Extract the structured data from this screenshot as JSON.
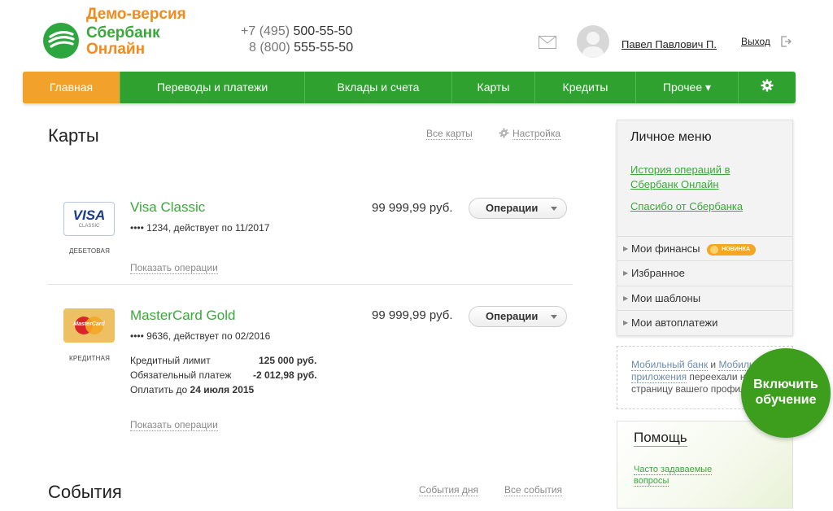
{
  "header": {
    "demo_label": "Демо-версия",
    "brand_line1": "Сбербанк",
    "brand_line2": "Онлайн",
    "phone1_prefix": "+7 (495)",
    "phone1_number": "500-55-50",
    "phone2_prefix": "8 (800)",
    "phone2_number": "555-55-50",
    "user_name": "Павел Павлович П.",
    "logout_label": "Выход"
  },
  "nav": {
    "items": [
      {
        "label": "Главная",
        "active": true
      },
      {
        "label": "Переводы и платежи"
      },
      {
        "label": "Вклады и счета"
      },
      {
        "label": "Карты"
      },
      {
        "label": "Кредиты"
      },
      {
        "label": "Прочее ▾"
      }
    ],
    "settings_icon": "gear-icon"
  },
  "cards_section": {
    "title": "Карты",
    "all_cards_link": "Все карты",
    "settings_link": "Настройка",
    "cards": [
      {
        "logo_text": "VISA",
        "logo_sub": "CLASSIC",
        "type_label": "ДЕБЕТОВАЯ",
        "name": "Visa Classic",
        "number_line": "•••• 1234, действует по 11/2017",
        "amount": "99 999,99 руб.",
        "ops_label": "Операции",
        "show_ops_link": "Показать операции"
      },
      {
        "logo_text": "MasterCard",
        "type_label": "КРЕДИТНАЯ",
        "name": "MasterCard Gold",
        "number_line": "•••• 9636, действует по 02/2016",
        "amount": "99 999,99 руб.",
        "ops_label": "Операции",
        "credit_limit_label": "Кредитный лимит",
        "credit_limit_value": "125 000 руб.",
        "mandatory_payment_label": "Обязательный платеж",
        "mandatory_payment_value": "-2 012,98 руб.",
        "pay_until_label": "Оплатить до",
        "pay_until_value": "24 июля 2015",
        "show_ops_link": "Показать операции"
      }
    ]
  },
  "events_section": {
    "title": "События",
    "day_events_link": "События дня",
    "all_events_link": "Все события"
  },
  "sidebar": {
    "title": "Личное меню",
    "links": [
      {
        "line1": "История операций в",
        "line2": "Сбербанк Онлайн"
      },
      {
        "line1": "Спасибо от Сбербанка"
      }
    ],
    "rows": [
      {
        "label": "Мои финансы",
        "badge": "НОВИНКА"
      },
      {
        "label": "Избранное"
      },
      {
        "label": "Мои шаблоны"
      },
      {
        "label": "Мои автоплатежи"
      }
    ],
    "mobile_notice": {
      "link1": "Мобильный банк",
      "and": " и ",
      "link2_part1": "Мобиль",
      "link2_part2": "приложения",
      "text1": " переехали н",
      "text2": "страницу вашего профил"
    },
    "help": {
      "title": "Помощь",
      "faq_line1": "Часто задаваемые",
      "faq_line2": "вопросы"
    },
    "tutorial_line1": "Включить",
    "tutorial_line2": "обучение"
  },
  "colors": {
    "brand_green": "#2ea12e",
    "brand_orange": "#f08c1e",
    "active_tab": "#f2a12a",
    "link_green": "#3aa83a"
  }
}
